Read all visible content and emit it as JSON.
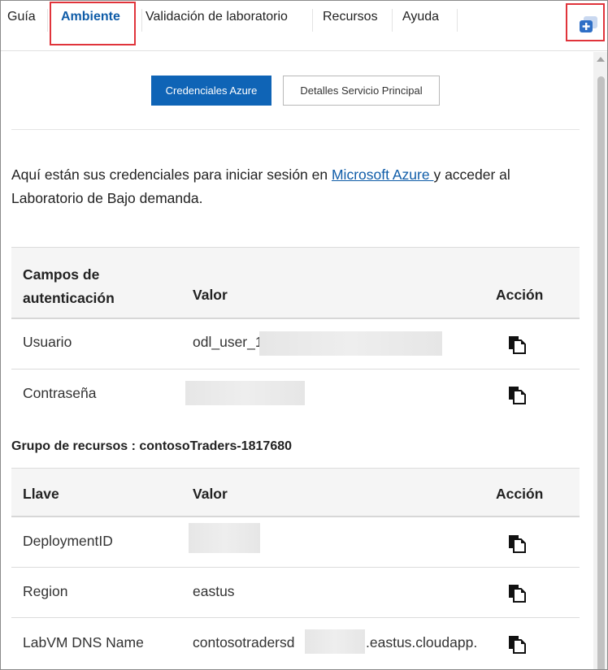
{
  "nav": {
    "tabs": [
      {
        "label": "Guía"
      },
      {
        "label": "Ambiente"
      },
      {
        "label": "Validación de laboratorio"
      },
      {
        "label": "Recursos"
      },
      {
        "label": "Ayuda"
      }
    ],
    "active_tab": "Ambiente",
    "new_window_icon": "open-new-window-icon"
  },
  "credentials_tabs": {
    "primary_label": "Credenciales Azure",
    "secondary_label": "Detalles Servicio Principal"
  },
  "intro": {
    "text_before": "Aquí están sus credenciales para iniciar sesión en ",
    "link_text": "Microsoft Azure ",
    "text_after": "y acceder al Laboratorio de Bajo demanda."
  },
  "auth_table": {
    "headers": [
      "Campos de autenticación",
      "Valor",
      "Acción"
    ],
    "rows": [
      {
        "field": "Usuario",
        "value": "odl_user_1"
      },
      {
        "field": "Contraseña",
        "value": ""
      }
    ]
  },
  "resource_group": {
    "title": "Grupo de recursos : contosoTraders-1817680",
    "headers": [
      "Llave",
      "Valor",
      "Acción"
    ],
    "rows": [
      {
        "key": "DeploymentID",
        "value": ""
      },
      {
        "key": "Region",
        "value": "eastus"
      },
      {
        "key": "LabVM DNS Name",
        "value_prefix": "contosotradersd",
        "value_suffix": ".eastus.cloudapp."
      }
    ]
  },
  "colors": {
    "accent": "#0f64b6",
    "link": "#0f5ca8",
    "highlight": "#e0343b"
  }
}
